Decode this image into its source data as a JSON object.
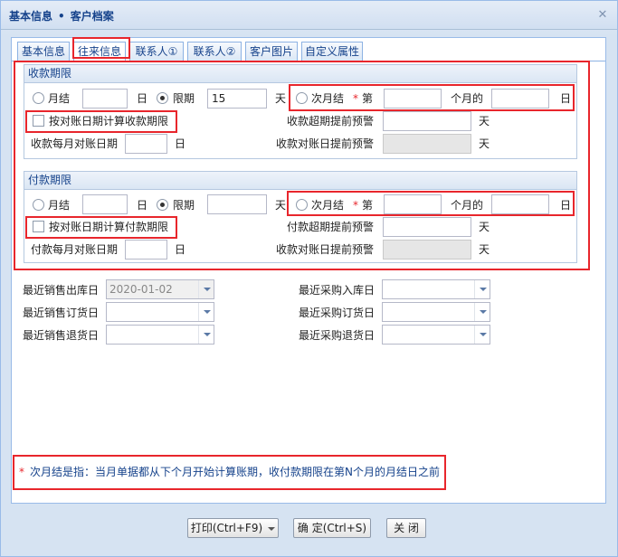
{
  "window": {
    "breadcrumb_1": "基本信息",
    "breadcrumb_sep": "•",
    "breadcrumb_2": "客户档案",
    "close_icon": "close-icon"
  },
  "tabs": [
    {
      "label": "基本信息"
    },
    {
      "label": "往来信息"
    },
    {
      "label": "联系人①"
    },
    {
      "label": "联系人②"
    },
    {
      "label": "客户图片"
    },
    {
      "label": "自定义属性"
    }
  ],
  "receivable": {
    "header": "收款期限",
    "opt_monthly": "月结",
    "unit_day": "日",
    "opt_term": "限期",
    "term_value": "15",
    "unit_day2": "天",
    "opt_next_month": "次月结",
    "required_star": "*",
    "nth_label": "第",
    "months_label": "个月的",
    "unit_day3": "日",
    "check_by_statement": "按对账日期计算收款期限",
    "overdue_warn_label": "收款超期提前预警",
    "overdue_unit": "天",
    "monthly_statement_label": "收款每月对账日期",
    "monthly_statement_unit": "日",
    "statement_warn_label": "收款对账日提前预警",
    "statement_warn_unit": "天"
  },
  "payable": {
    "header": "付款期限",
    "opt_monthly": "月结",
    "unit_day": "日",
    "opt_term": "限期",
    "term_value": "",
    "unit_day2": "天",
    "opt_next_month": "次月结",
    "required_star": "*",
    "nth_label": "第",
    "months_label": "个月的",
    "unit_day3": "日",
    "check_by_statement": "按对账日期计算付款期限",
    "overdue_warn_label": "付款超期提前预警",
    "overdue_unit": "天",
    "monthly_statement_label": "付款每月对账日期",
    "monthly_statement_unit": "日",
    "statement_warn_label": "收款对账日提前预警",
    "statement_warn_unit": "天"
  },
  "dates": {
    "last_sale_out_label": "最近销售出库日",
    "last_sale_out_value": "2020-01-02",
    "last_sale_order_label": "最近销售订货日",
    "last_sale_return_label": "最近销售退货日",
    "last_purchase_in_label": "最近采购入库日",
    "last_purchase_order_label": "最近采购订货日",
    "last_purchase_return_label": "最近采购退货日"
  },
  "note": {
    "star": "*",
    "text": "次月结是指：当月单据都从下个月开始计算账期，收付款期限在第N个月的月结日之前"
  },
  "buttons": {
    "print": "打印(Ctrl+F9)",
    "confirm": "确 定(Ctrl+S)",
    "close": "关 闭"
  },
  "colors": {
    "highlight_border": "#e8262c",
    "title_text": "#15428b"
  }
}
